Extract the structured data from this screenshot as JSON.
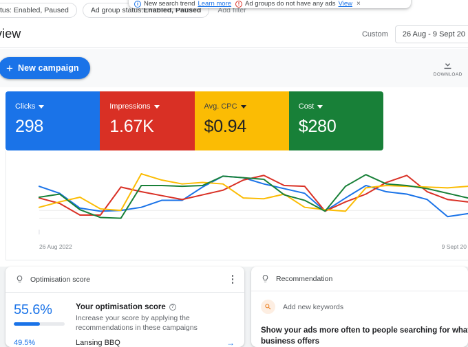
{
  "notifications": [
    {
      "icon": "info-icon",
      "text": "New search trend",
      "link": "Learn more",
      "tone": "blue"
    },
    {
      "icon": "warning-icon",
      "text": "Ad groups do not have any ads",
      "link": "View",
      "tone": "red"
    }
  ],
  "notification_close": "×",
  "filters": {
    "chip_campaign_status": "tus: Enabled, Paused",
    "chip_adgroup_status_prefix": "Ad group status: ",
    "chip_adgroup_status_value": "Enabled, Paused",
    "add_filter": "Add filter"
  },
  "header": {
    "title": "view",
    "custom_label": "Custom",
    "date_range": "26 Aug - 9 Sept 20"
  },
  "action_bar": {
    "new_campaign": "New campaign",
    "plus_glyph": "+",
    "download_label": "DOWNLOAD"
  },
  "metrics": [
    {
      "label": "Clicks",
      "value": "298",
      "bg": "#1a73e8",
      "text": "light"
    },
    {
      "label": "Impressions",
      "value": "1.67K",
      "bg": "#d93025",
      "text": "light"
    },
    {
      "label": "Avg. CPC",
      "value": "$0.94",
      "bg": "#fbbc04",
      "text": "dark"
    },
    {
      "label": "Cost",
      "value": "$280",
      "bg": "#188038",
      "text": "light"
    }
  ],
  "chart_data": {
    "type": "line",
    "title": "",
    "xlabel": "",
    "ylabel": "",
    "x_tick_labels": [
      "26 Aug 2022",
      "9 Sept 20"
    ],
    "x": [
      0,
      1,
      2,
      3,
      4,
      5,
      6,
      7,
      8,
      9,
      10,
      11,
      12,
      13,
      14,
      15,
      16,
      17,
      18,
      19,
      20,
      21
    ],
    "grid": true,
    "gridlines_y": [
      2,
      3
    ],
    "legend": "none",
    "ylim": [
      0,
      10
    ],
    "series": [
      {
        "name": "Clicks",
        "color": "#1a73e8",
        "values": [
          6.1,
          5.2,
          3.3,
          2.9,
          3.0,
          3.4,
          4.3,
          4.3,
          6.0,
          7.4,
          7.2,
          6.4,
          5.8,
          5.2,
          2.9,
          4.6,
          6.2,
          5.4,
          5.1,
          4.4,
          2.2,
          2.6
        ]
      },
      {
        "name": "Impressions",
        "color": "#d93025",
        "values": [
          4.6,
          3.9,
          2.4,
          2.4,
          6.0,
          5.4,
          4.9,
          4.4,
          5.0,
          5.6,
          6.9,
          7.5,
          6.2,
          6.1,
          2.9,
          4.1,
          5.1,
          6.6,
          7.5,
          5.4,
          4.4,
          4.1
        ]
      },
      {
        "name": "Avg. CPC",
        "color": "#fbbc04",
        "values": [
          3.4,
          4.1,
          4.7,
          3.2,
          3.0,
          7.7,
          6.9,
          6.4,
          6.6,
          6.4,
          4.6,
          4.5,
          5.1,
          3.4,
          3.1,
          2.9,
          5.9,
          6.2,
          6.1,
          6.0,
          5.9,
          6.1
        ]
      },
      {
        "name": "Cost",
        "color": "#188038",
        "values": [
          4.7,
          5.1,
          3.1,
          2.1,
          2.0,
          6.2,
          6.2,
          6.1,
          6.2,
          7.4,
          7.2,
          7.0,
          5.0,
          4.3,
          2.9,
          6.1,
          7.6,
          6.4,
          6.2,
          5.8,
          5.2,
          4.6
        ]
      }
    ]
  },
  "optimisation_card": {
    "header_icon": "lightbulb-icon",
    "header_title": "Optimisation score",
    "menu_icon": "kebab-menu-icon",
    "score_pct": "55.6%",
    "score_fill_pct": 52,
    "heading": "Your optimisation score",
    "help_glyph": "?",
    "subtext": "Increase your score by applying the recommendations in these campaigns",
    "rows": [
      {
        "pct": "49.5%",
        "name": "Lansing BBQ",
        "arrow": "→"
      }
    ]
  },
  "recommendation_card": {
    "header_icon": "lightbulb-icon",
    "header_title": "Recommendation",
    "keyword_icon": "search-icon",
    "keyword_label": "Add new keywords",
    "description_line1": "Show your ads more often to people searching for what yo",
    "description_line2": "business offers"
  }
}
